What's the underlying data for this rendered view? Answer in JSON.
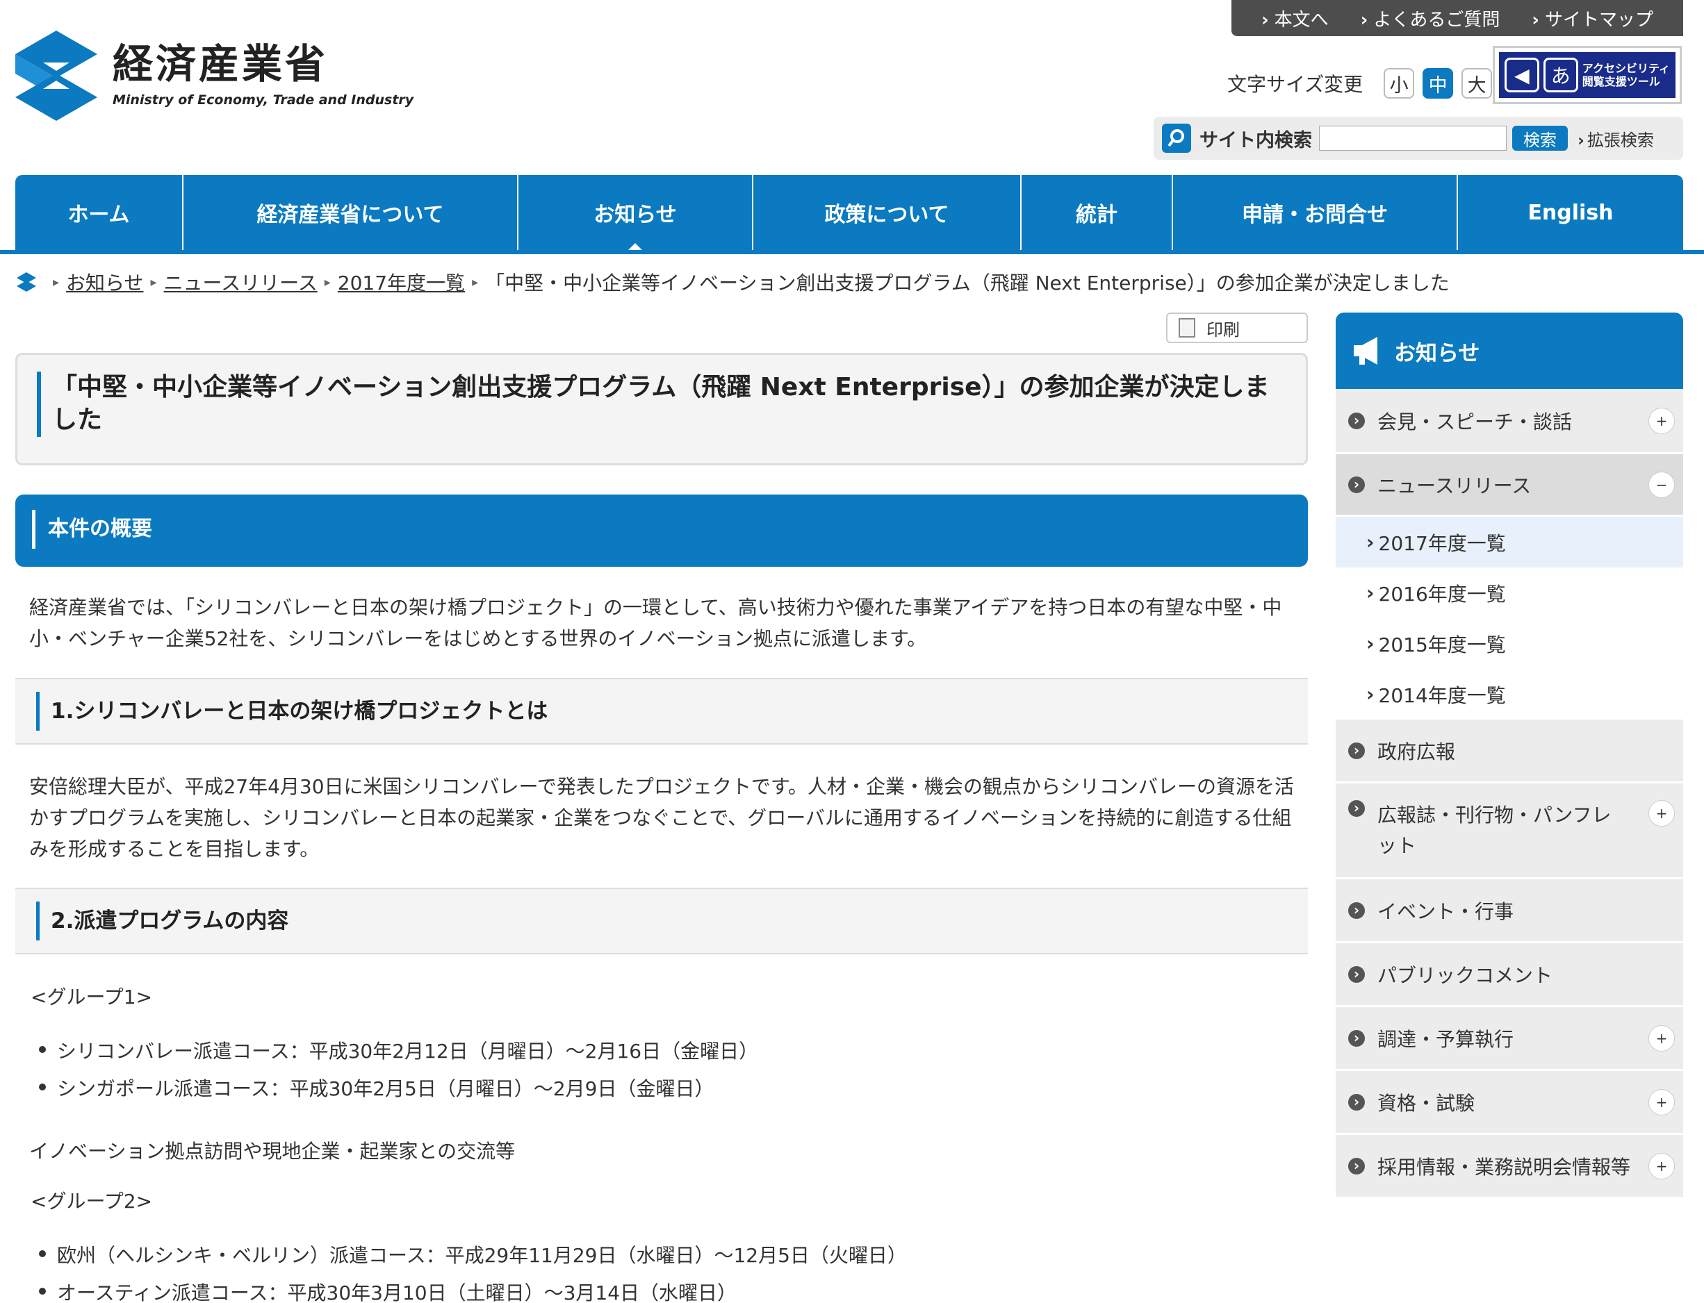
{
  "util_nav": [
    "本文へ",
    "よくあるご質問",
    "サイトマップ"
  ],
  "logo": {
    "jp": "経済産業省",
    "en": "Ministry of Economy, Trade and Industry"
  },
  "font_size": {
    "label": "文字サイズ変更",
    "small": "小",
    "medium": "中",
    "large": "大",
    "selected": "中"
  },
  "accessibility": {
    "line1": "アクセシビリティ",
    "line2": "閲覧支援ツール"
  },
  "search": {
    "label": "サイト内検索",
    "value": "",
    "button": "検索",
    "advanced": "拡張検索"
  },
  "gnav": [
    "ホーム",
    "経済産業省について",
    "お知らせ",
    "政策について",
    "統計",
    "申請・お問合せ",
    "English"
  ],
  "breadcrumb": {
    "items": [
      "お知らせ",
      "ニュースリリース",
      "2017年度一覧"
    ],
    "current": "「中堅・中小企業等イノベーション創出支援プログラム（飛躍 Next Enterprise）」の参加企業が決定しました"
  },
  "print_label": "印刷",
  "main": {
    "title": "「中堅・中小企業等イノベーション創出支援プログラム（飛躍 Next Enterprise）」の参加企業が決定しました",
    "overview_heading": "本件の概要",
    "overview_text": "経済産業省では、「シリコンバレーと日本の架け橋プロジェクト」の一環として、高い技術力や優れた事業アイデアを持つ日本の有望な中堅・中小・ベンチャー企業52社を、シリコンバレーをはじめとする世界のイノベーション拠点に派遣します。",
    "section1_heading": "1.シリコンバレーと日本の架け橋プロジェクトとは",
    "section1_text": "安倍総理大臣が、平成27年4月30日に米国シリコンバレーで発表したプロジェクトです。人材・企業・機会の観点からシリコンバレーの資源を活かすプログラムを実施し、シリコンバレーと日本の起業家・企業をつなぐことで、グローバルに通用するイノベーションを持続的に創造する仕組みを形成することを目指します。",
    "section2_heading": "2.派遣プログラムの内容",
    "group1_label": "<グループ1>",
    "group1_items": [
      "シリコンバレー派遣コース：平成30年2月12日（月曜日）～2月16日（金曜日）",
      "シンガポール派遣コース：平成30年2月5日（月曜日）～2月9日（金曜日）"
    ],
    "group1_note": "イノベーション拠点訪問や現地企業・起業家との交流等",
    "group2_label": "<グループ2>",
    "group2_items": [
      "欧州（ヘルシンキ・ベルリン）派遣コース：平成29年11月29日（水曜日）～12月5日（火曜日）",
      "オースティン派遣コース：平成30年3月10日（土曜日）～3月14日（水曜日）"
    ]
  },
  "sidebar": {
    "title": "お知らせ",
    "items": [
      {
        "label": "会見・スピーチ・談話",
        "toggle": "+"
      },
      {
        "label": "ニュースリリース",
        "toggle": "−"
      },
      {
        "label": "政府広報",
        "toggle": ""
      },
      {
        "label": "広報誌・刊行物・パンフレット",
        "toggle": "+"
      },
      {
        "label": "イベント・行事",
        "toggle": ""
      },
      {
        "label": "パブリックコメント",
        "toggle": ""
      },
      {
        "label": "調達・予算執行",
        "toggle": "+"
      },
      {
        "label": "資格・試験",
        "toggle": "+"
      },
      {
        "label": "採用情報・業務説明会情報等",
        "toggle": "+"
      }
    ],
    "sub_items": [
      "2017年度一覧",
      "2016年度一覧",
      "2015年度一覧",
      "2014年度一覧"
    ],
    "current_sub": "2017年度一覧"
  },
  "colors": {
    "brand_blue": "#0b7ac0",
    "util_bar": "#4d4d4d",
    "side_bg": "#ececec"
  }
}
